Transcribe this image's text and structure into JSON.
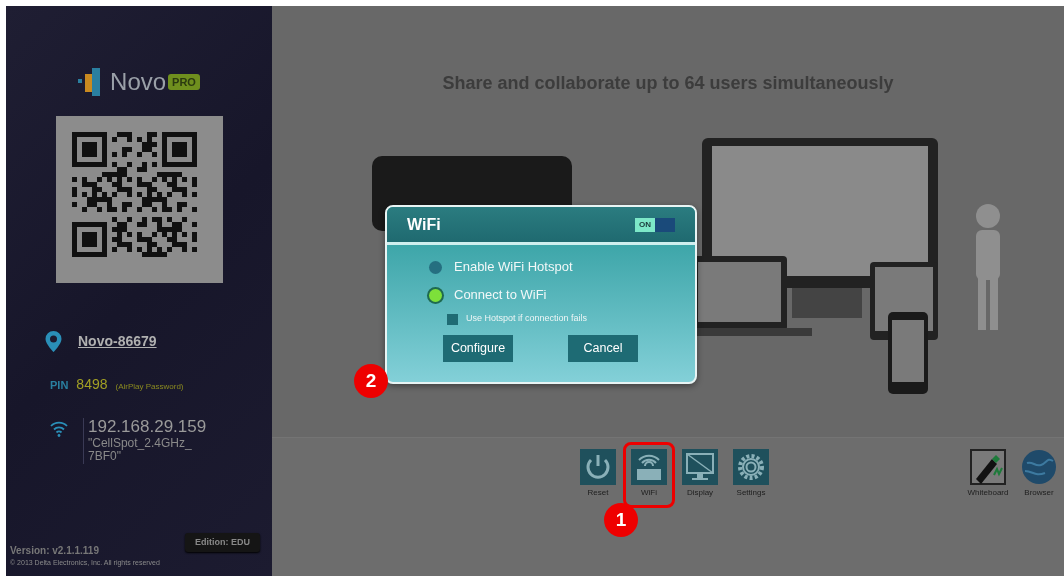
{
  "sidebar": {
    "logo": {
      "brand": "Novo",
      "badge": "PRO"
    },
    "device_name": "Novo-86679",
    "pin": {
      "label": "PIN",
      "value": "8498",
      "note": "(AirPlay Password)"
    },
    "network": {
      "ip": "192.168.29.159",
      "ssid_lines": [
        "\"CellSpot_2.4GHz_",
        "7BF0\""
      ]
    },
    "version": "Version: v2.1.1.119",
    "copyright": "© 2013 Delta Electronics, Inc. All rights reserved",
    "edition": "Edition: EDU"
  },
  "main": {
    "headline": "Share and collaborate up to **64 users** simultaneously",
    "dialog": {
      "title": "WiFi",
      "toggle": {
        "label": "ON",
        "on": true
      },
      "options": [
        {
          "label": "Enable WiFi Hotspot",
          "selected": false
        },
        {
          "label": "Connect to WiFi",
          "selected": true
        }
      ],
      "checkbox": {
        "label": "Use Hotspot if connection fails",
        "checked": false
      },
      "buttons": [
        "Configure",
        "Cancel"
      ]
    },
    "dock_left": [
      {
        "kind": "reset",
        "label": "Reset",
        "highlighted": false
      },
      {
        "kind": "wifi",
        "label": "WiFi",
        "highlighted": true
      },
      {
        "kind": "display",
        "label": "Display",
        "highlighted": false
      },
      {
        "kind": "settings",
        "label": "Settings",
        "highlighted": false
      }
    ],
    "dock_right": [
      {
        "kind": "whiteboard",
        "label": "Whiteboard",
        "highlighted": false
      },
      {
        "kind": "browser",
        "label": "Browser",
        "highlighted": false
      }
    ],
    "callouts": [
      {
        "number": "1"
      },
      {
        "number": "2"
      }
    ]
  }
}
